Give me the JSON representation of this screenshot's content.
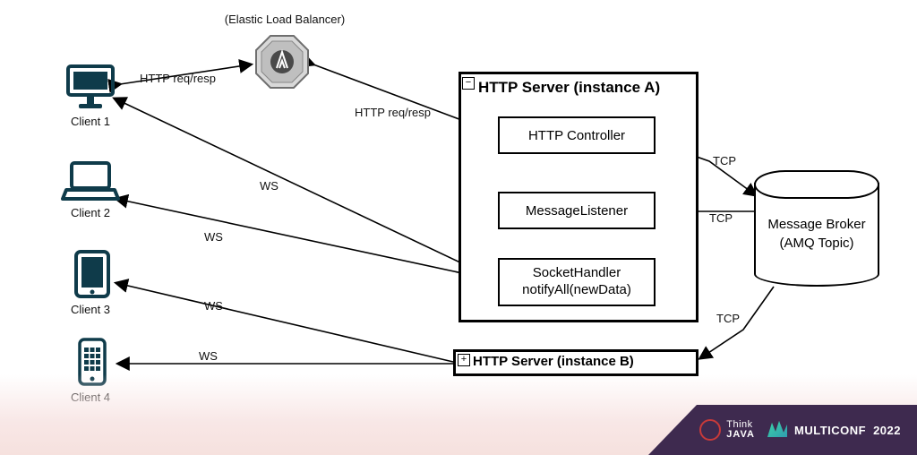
{
  "elb_label": "(Elastic Load Balancer)",
  "edges": {
    "http1": "HTTP req/resp",
    "http2": "HTTP req/resp",
    "ws": "WS",
    "tcp": "TCP"
  },
  "clients": [
    {
      "name": "Client 1"
    },
    {
      "name": "Client 2"
    },
    {
      "name": "Client 3"
    },
    {
      "name": "Client 4"
    }
  ],
  "server_a": {
    "title": "HTTP Server (instance A)",
    "collapse_glyph": "−",
    "boxes": {
      "controller": "HTTP Controller",
      "listener": "MessageListener",
      "socket_l1": "SocketHandler",
      "socket_l2": "notifyAll(newData)"
    }
  },
  "server_b": {
    "title": "HTTP Server (instance B)",
    "expand_glyph": "+"
  },
  "broker": {
    "line1": "Message Broker",
    "line2": "(AMQ Topic)"
  },
  "footer": {
    "think": "Think",
    "java": "JAVA",
    "multiconf": "MULTICONF",
    "year": "2022"
  }
}
